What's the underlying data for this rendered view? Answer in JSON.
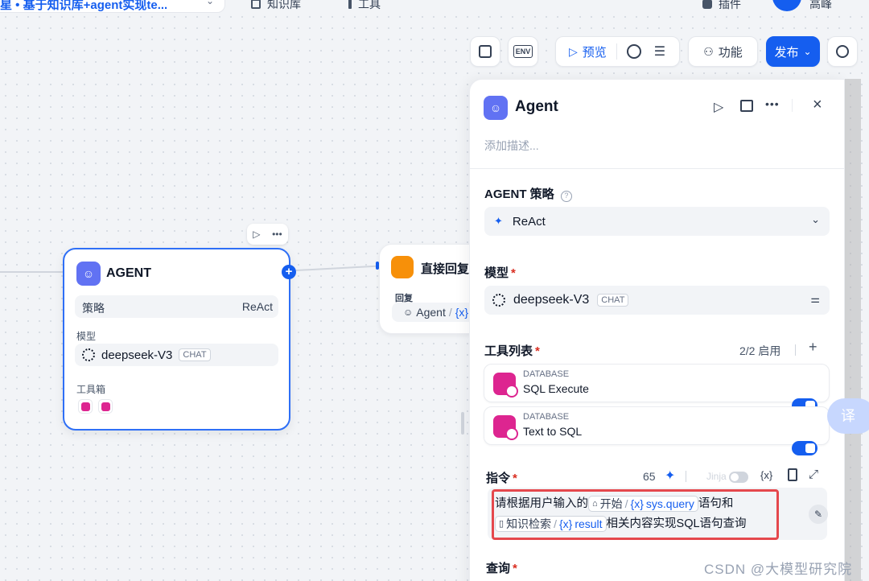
{
  "header": {
    "breadcrumb": "星 • 基于知识库+agent实现te...",
    "tab_knowledge": "知识库",
    "tab_tools": "工具",
    "tab_plugins": "插件",
    "user_name": "高峰"
  },
  "toolbar": {
    "env_label": "ENV",
    "preview_label": "预览",
    "features_label": "功能",
    "publish_label": "发布"
  },
  "canvas": {
    "agent_node": {
      "title": "AGENT",
      "strategy_label": "策略",
      "strategy_value": "ReAct",
      "model_label": "模型",
      "model_name": "deepseek-V3",
      "model_tag": "CHAT",
      "toolbox_label": "工具箱"
    },
    "reply_node": {
      "title": "直接回复",
      "field_label": "回复",
      "ref_node": "Agent",
      "ref_sep": "/",
      "ref_var": "{x}"
    }
  },
  "panel": {
    "title": "Agent",
    "description_placeholder": "添加描述...",
    "strategy": {
      "label": "AGENT 策略",
      "value": "ReAct"
    },
    "model": {
      "label": "模型",
      "required": "*",
      "name": "deepseek-V3",
      "tag": "CHAT"
    },
    "tools": {
      "label": "工具列表",
      "required": "*",
      "count": "2/2 启用",
      "items": [
        {
          "category": "DATABASE",
          "name": "SQL Execute",
          "enabled": true
        },
        {
          "category": "DATABASE",
          "name": "Text to SQL",
          "enabled": true
        }
      ]
    },
    "instruction": {
      "label": "指令",
      "required": "*",
      "count": "65",
      "jinja": "Jinja",
      "var_icon": "{x}",
      "text_1": "请根据用户输入的",
      "tag_1_node": "开始",
      "tag_1_var": "sys.query",
      "text_2": "语句和",
      "tag_2_node": "知识检索",
      "tag_2_var": "result",
      "text_3": "相关内容实现SQL语句查询"
    },
    "query": {
      "label": "查询",
      "required": "*"
    }
  },
  "overlay": {
    "translate_button": "译",
    "watermark": "CSDN @大模型研究院"
  }
}
